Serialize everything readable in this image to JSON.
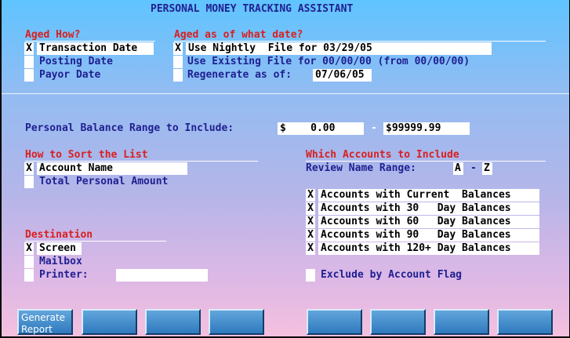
{
  "header": {
    "title": "PERSONAL MONEY TRACKING ASSISTANT"
  },
  "aged_how": {
    "heading": "Aged How?",
    "options": [
      {
        "mark": "X",
        "label": "Transaction Date"
      },
      {
        "mark": "",
        "label": "Posting Date"
      },
      {
        "mark": "",
        "label": "Payor Date"
      }
    ]
  },
  "aged_as_of": {
    "heading": "Aged as of what date?",
    "options": [
      {
        "mark": "X",
        "label": "Use Nightly  File for 03/29/05"
      },
      {
        "mark": "",
        "label": "Use Existing File for 00/00/00 (from 00/00/00)"
      },
      {
        "mark": "",
        "label": "Regenerate as of:",
        "value": "07/06/05"
      }
    ]
  },
  "balance_range": {
    "label": "Personal Balance Range to Include:",
    "from": "$    0.00",
    "separator": "-",
    "to": "$99999.99"
  },
  "sort": {
    "heading": "How to Sort the List",
    "options": [
      {
        "mark": "X",
        "label": "Account Name"
      },
      {
        "mark": "",
        "label": "Total Personal Amount"
      }
    ]
  },
  "destination": {
    "heading": "Destination",
    "options": [
      {
        "mark": "X",
        "label": "Screen"
      },
      {
        "mark": "",
        "label": "Mailbox"
      },
      {
        "mark": "",
        "label": "Printer:",
        "value": ""
      }
    ]
  },
  "accounts": {
    "heading": "Which Accounts to Include",
    "range_label": "Review Name Range:",
    "range_from": "A",
    "range_sep": "-",
    "range_to": "Z",
    "options": [
      {
        "mark": "X",
        "label": "Accounts with Current  Balances"
      },
      {
        "mark": "X",
        "label": "Accounts with 30   Day Balances"
      },
      {
        "mark": "X",
        "label": "Accounts with 60   Day Balances"
      },
      {
        "mark": "X",
        "label": "Accounts with 90   Day Balances"
      },
      {
        "mark": "X",
        "label": "Accounts with 120+ Day Balances"
      }
    ],
    "exclude": {
      "mark": "",
      "label": "Exclude by Account Flag"
    }
  },
  "buttons": [
    {
      "label": "Generate\nReport"
    },
    {
      "label": ""
    },
    {
      "label": ""
    },
    {
      "label": ""
    },
    {
      "label": ""
    },
    {
      "label": ""
    },
    {
      "label": ""
    },
    {
      "label": ""
    }
  ],
  "colors": {
    "heading": "#d82020",
    "text": "#202090",
    "button": "#2f79bd"
  }
}
